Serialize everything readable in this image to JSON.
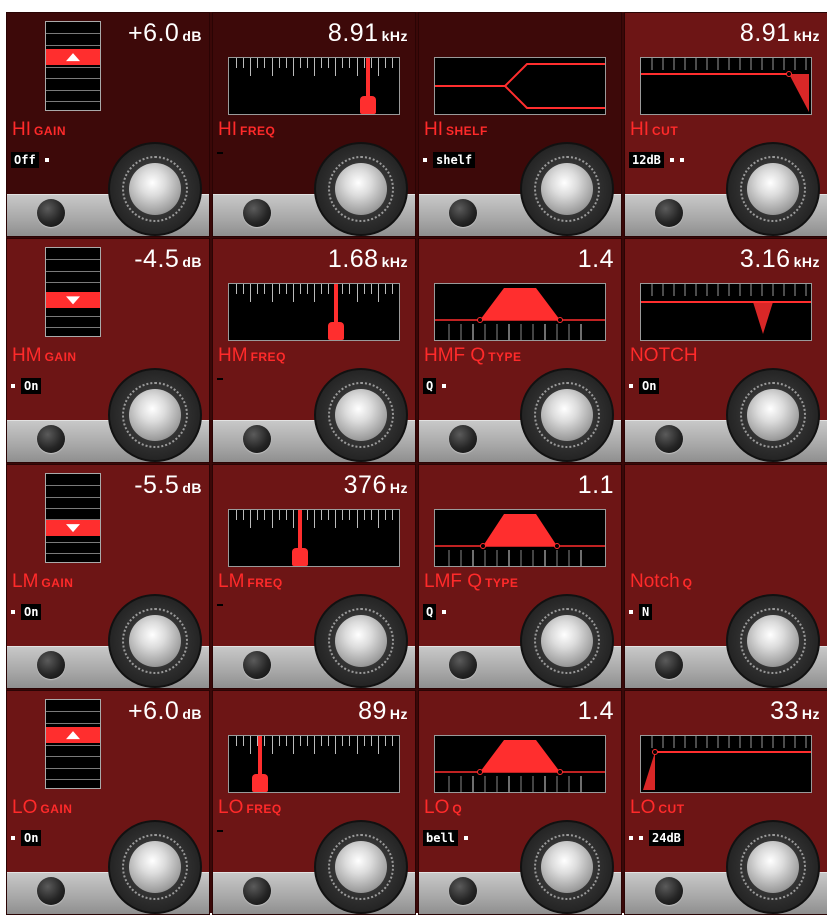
{
  "colors": {
    "panel": "#6d1515",
    "panel_dark": "#3d0909",
    "accent": "#ff2e2e",
    "text": "#ffffff",
    "label": "#ff2a2a"
  },
  "rows": [
    {
      "gain": {
        "value": "+6.0",
        "unit": "dB",
        "label": "HI",
        "label_sub": "GAIN",
        "mode_box": "Off",
        "mode_dots": 1,
        "level": 6.0
      },
      "freq": {
        "value": "8.91",
        "unit": "kHz",
        "label": "HI",
        "label_sub": "FREQ",
        "freq_fraction": 0.82
      },
      "third": {
        "kind": "shelf",
        "value": "",
        "label": "HI",
        "label_sub": "SHELF",
        "mode_box": "shelf",
        "mode_dots_before": 1
      },
      "fourth": {
        "kind": "hicut",
        "value": "8.91",
        "unit": "kHz",
        "label": "HI",
        "label_sub": "CUT",
        "mode_box": "12dB",
        "mode_dots": 2
      }
    },
    {
      "gain": {
        "value": "-4.5",
        "unit": "dB",
        "label": "HM",
        "label_sub": "GAIN",
        "mode_box": "On",
        "mode_dots_before": 1,
        "level": -4.5
      },
      "freq": {
        "value": "1.68",
        "unit": "kHz",
        "label": "HM",
        "label_sub": "FREQ",
        "freq_fraction": 0.63
      },
      "third": {
        "kind": "bell",
        "value": "1.4",
        "label": "HMF Q",
        "label_sub": "TYPE",
        "mode_box": "Q",
        "mode_dots": 1,
        "width": 1.4
      },
      "fourth": {
        "kind": "notch",
        "value": "3.16",
        "unit": "kHz",
        "label": "NOTCH",
        "label_sub": "",
        "mode_box": "On",
        "mode_dots_before": 1
      }
    },
    {
      "gain": {
        "value": "-5.5",
        "unit": "dB",
        "label": "LM",
        "label_sub": "GAIN",
        "mode_box": "On",
        "mode_dots_before": 1,
        "level": -5.5
      },
      "freq": {
        "value": "376",
        "unit": "Hz",
        "label": "LM",
        "label_sub": "FREQ",
        "freq_fraction": 0.42
      },
      "third": {
        "kind": "bell",
        "value": "1.1",
        "label": "LMF Q",
        "label_sub": "TYPE",
        "mode_box": "Q",
        "mode_dots": 1,
        "width": 1.1
      },
      "fourth": {
        "kind": "notchq",
        "value": "",
        "label": "Notch",
        "label_sub": "Q",
        "mode_box": "N",
        "mode_dots_before": 1
      }
    },
    {
      "gain": {
        "value": "+6.0",
        "unit": "dB",
        "label": "LO",
        "label_sub": "GAIN",
        "mode_box": "On",
        "mode_dots_before": 1,
        "level": 6.0
      },
      "freq": {
        "value": "89",
        "unit": "Hz",
        "label": "LO",
        "label_sub": "FREQ",
        "freq_fraction": 0.18
      },
      "third": {
        "kind": "bell",
        "value": "1.4",
        "label": "LO",
        "label_sub": "Q",
        "mode_box": "bell",
        "mode_dots": 1,
        "width": 1.4
      },
      "fourth": {
        "kind": "locut",
        "value": "33",
        "unit": "Hz",
        "label": "LO",
        "label_sub": "CUT",
        "mode_box": "24dB",
        "mode_dots_before": 2
      }
    }
  ]
}
